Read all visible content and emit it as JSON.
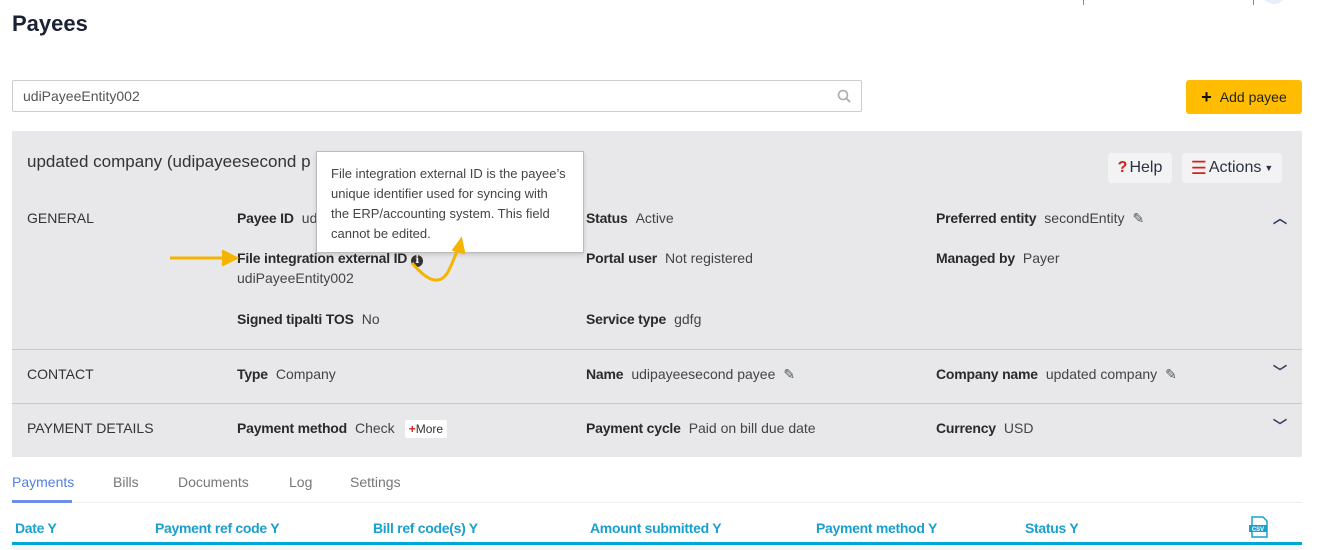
{
  "page": {
    "title": "Payees"
  },
  "search": {
    "value": "udiPayeeEntity002"
  },
  "add_payee": {
    "label": "Add payee",
    "icon": "plus-icon"
  },
  "payee": {
    "title": "updated company (udipayeesecond p",
    "help_label": "Help",
    "actions_label": "Actions",
    "sections": {
      "general": {
        "label": "GENERAL",
        "payee_id": {
          "label": "Payee ID",
          "value": "ud"
        },
        "file_integration": {
          "label": "File integration external ID",
          "value": "udiPayeeEntity002"
        },
        "signed_tos": {
          "label": "Signed tipalti TOS",
          "value": "No"
        },
        "status": {
          "label": "Status",
          "value": "Active"
        },
        "portal_user": {
          "label": "Portal user",
          "value": "Not registered"
        },
        "service_type": {
          "label": "Service type",
          "value": "gdfg"
        },
        "preferred_entity": {
          "label": "Preferred entity",
          "value": "secondEntity"
        },
        "managed_by": {
          "label": "Managed by",
          "value": "Payer"
        }
      },
      "contact": {
        "label": "CONTACT",
        "type": {
          "label": "Type",
          "value": "Company"
        },
        "name": {
          "label": "Name",
          "value": "udipayeesecond payee"
        },
        "company_name": {
          "label": "Company name",
          "value": "updated company"
        }
      },
      "payment": {
        "label": "PAYMENT DETAILS",
        "method": {
          "label": "Payment method",
          "value": "Check"
        },
        "more_label": "More",
        "cycle": {
          "label": "Payment cycle",
          "value": "Paid on bill due date"
        },
        "currency": {
          "label": "Currency",
          "value": "USD"
        }
      }
    }
  },
  "tooltip": {
    "text": "File integration external ID is the payee’s unique identifier used for syncing with the ERP/accounting system. This field cannot be edited."
  },
  "tabs": [
    "Payments",
    "Bills",
    "Documents",
    "Log",
    "Settings"
  ],
  "active_tab": "Payments",
  "table": {
    "columns": [
      "Date",
      "Payment ref code",
      "Bill ref code(s)",
      "Amount submitted",
      "Payment method",
      "Status"
    ],
    "export_icon": "csv-icon"
  },
  "colors": {
    "accent": "#ffbc00",
    "link": "#1aa0cf",
    "annotation": "#f5b400"
  }
}
